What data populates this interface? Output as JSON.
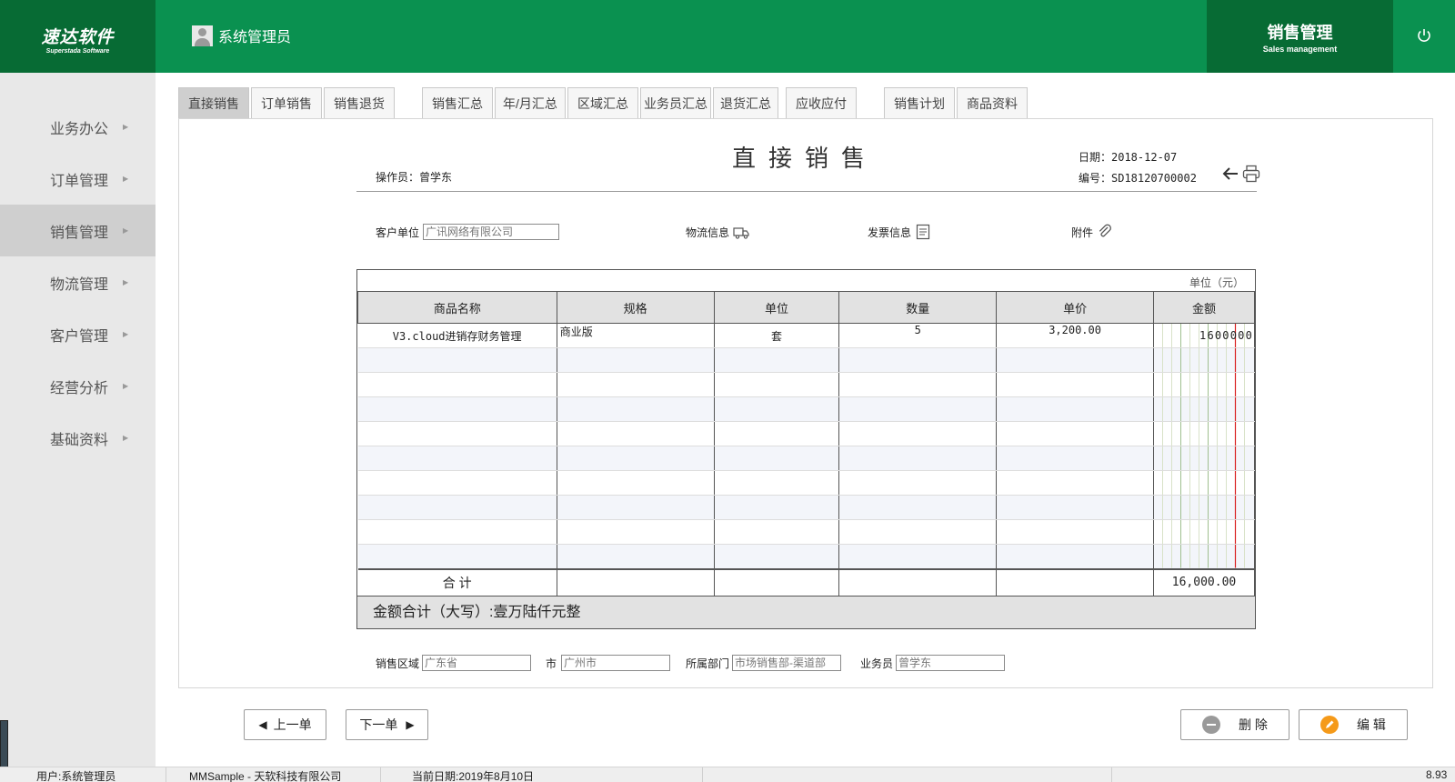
{
  "header": {
    "logo_main": "速达软件",
    "logo_sub": "Superstada Software",
    "user": "系统管理员",
    "module_main": "销售管理",
    "module_sub": "Sales management",
    "accent_color": "#0a9150",
    "dark_color": "#076b34"
  },
  "sidebar": {
    "items": [
      {
        "label": "业务办公"
      },
      {
        "label": "订单管理"
      },
      {
        "label": "销售管理"
      },
      {
        "label": "物流管理"
      },
      {
        "label": "客户管理"
      },
      {
        "label": "经营分析"
      },
      {
        "label": "基础资料"
      }
    ],
    "active_index": 2
  },
  "tabs": [
    {
      "label": "直接销售"
    },
    {
      "label": "订单销售"
    },
    {
      "label": "销售退货"
    },
    {
      "label": "销售汇总"
    },
    {
      "label": "年/月汇总"
    },
    {
      "label": "区域汇总"
    },
    {
      "label": "业务员汇总"
    },
    {
      "label": "退货汇总"
    },
    {
      "label": "应收应付"
    },
    {
      "label": "销售计划"
    },
    {
      "label": "商品资料"
    }
  ],
  "doc": {
    "title": "直接销售",
    "operator": "操作员：曾学东",
    "date": "日期：2018-12-07",
    "number": "编号：SD18120700002"
  },
  "info": {
    "customer_label": "客户单位",
    "customer_value": "广讯网络有限公司",
    "logistics_label": "物流信息",
    "invoice_label": "发票信息",
    "attachment_label": "附件"
  },
  "grid": {
    "unit_caption": "单位（元）",
    "columns": [
      "商品名称",
      "规格",
      "单位",
      "数量",
      "单价",
      "金额"
    ],
    "rows": [
      {
        "name": "V3.cloud进销存财务管理",
        "spec": "商业版",
        "unit": "套",
        "qty": "5",
        "price": "3,200.00",
        "amount_digits": "1600000"
      }
    ],
    "total_label": "合 计",
    "total_amount": "16,000.00",
    "capital_text": "金额合计（大写）:壹万陆仟元整"
  },
  "footer_fields": {
    "region_label": "销售区域",
    "region_value": "广东省",
    "city_label": "市",
    "city_value": "广州市",
    "dept_label": "所属部门",
    "dept_value": "市场销售部-渠道部",
    "salesman_label": "业务员",
    "salesman_value": "曾学东"
  },
  "buttons": {
    "prev": "上一单",
    "next": "下一单",
    "delete": "删 除",
    "edit": "编 辑"
  },
  "status": {
    "user": "用户:系统管理员",
    "app": "MMSample - 天软科技有限公司",
    "date": "当前日期:2019年8月10日",
    "version": "8.93"
  }
}
